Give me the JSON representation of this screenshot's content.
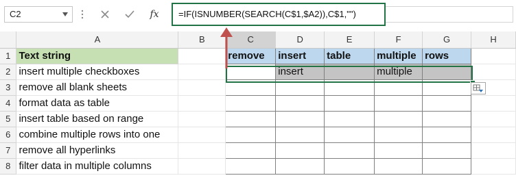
{
  "name_box": {
    "value": "C2",
    "dropdown_icon": "chevron-down-icon"
  },
  "formula_bar": {
    "more_icon": "vertical-dots-icon",
    "cancel_icon": "close-icon",
    "enter_icon": "check-icon",
    "fx_label": "fx",
    "formula": "=IF(ISNUMBER(SEARCH(C$1,$A2)),C$1,\"\")"
  },
  "columns": [
    "A",
    "B",
    "C",
    "D",
    "E",
    "F",
    "G",
    "H"
  ],
  "rows": [
    {
      "num": "1",
      "a": "Text string",
      "c": "remove",
      "d": "insert",
      "e": "table",
      "f": "multiple",
      "g": "rows"
    },
    {
      "num": "2",
      "a": "insert multiple checkboxes",
      "c": "",
      "d": "insert",
      "e": "",
      "f": "multiple",
      "g": ""
    },
    {
      "num": "3",
      "a": "remove all blank sheets"
    },
    {
      "num": "4",
      "a": "format data as table"
    },
    {
      "num": "5",
      "a": "insert table based on range"
    },
    {
      "num": "6",
      "a": "combine multiple rows into one"
    },
    {
      "num": "7",
      "a": "remove all hyperlinks"
    },
    {
      "num": "8",
      "a": "filter data in multiple columns"
    }
  ],
  "flash_fill_icon": "flash-fill-options-icon",
  "colors": {
    "accent": "#217346",
    "header_green": "#c6e0b4",
    "header_blue": "#bdd7ee",
    "result_gray": "#c4c4c4",
    "arrow": "#c0504d"
  }
}
